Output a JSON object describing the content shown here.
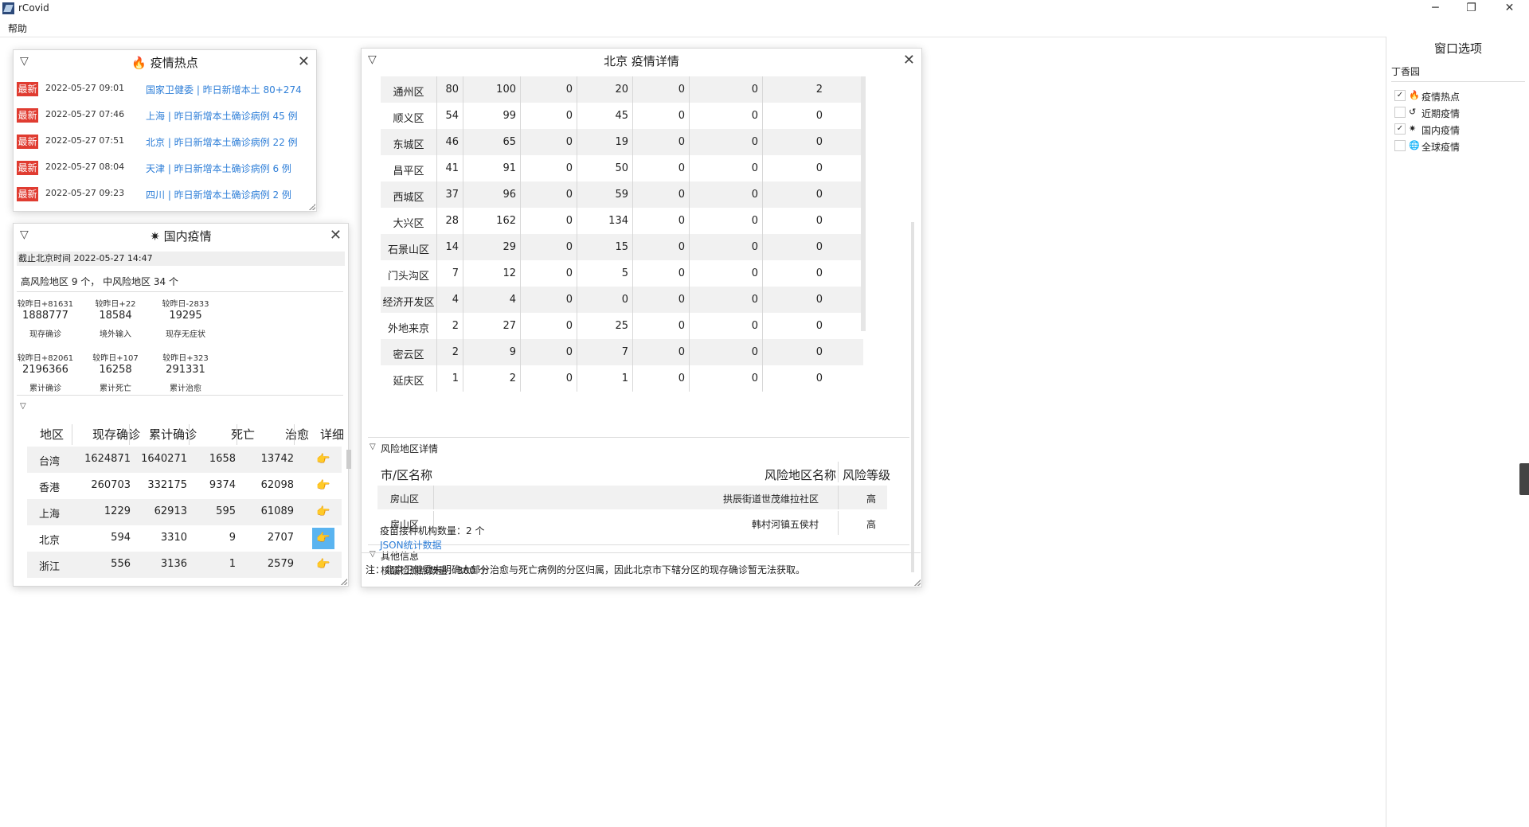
{
  "app": {
    "title": "rCovid"
  },
  "menu": {
    "help": "帮助"
  },
  "window_controls": {
    "minimize": "─",
    "restore": "❐",
    "close": "✕"
  },
  "hot": {
    "title": "疫情热点",
    "items": [
      {
        "badge": "最新",
        "time": "2022-05-27 09:01",
        "text": "国家卫健委 | 昨日新增本土 80+274"
      },
      {
        "badge": "最新",
        "time": "2022-05-27 07:46",
        "text": "上海 | 昨日新增本土确诊病例 45 例"
      },
      {
        "badge": "最新",
        "time": "2022-05-27 07:51",
        "text": "北京 | 昨日新增本土确诊病例 22 例"
      },
      {
        "badge": "最新",
        "time": "2022-05-27 08:04",
        "text": "天津 | 昨日新增本土确诊病例 6 例"
      },
      {
        "badge": "最新",
        "time": "2022-05-27 09:23",
        "text": "四川 | 昨日新增本土确诊病例 2 例"
      }
    ]
  },
  "domestic": {
    "title": "国内疫情",
    "deadline": "截止北京时间 2022-05-27 14:47",
    "risk": "高风险地区 9 个，  中风险地区 34 个",
    "stats_row1": [
      {
        "delta": "较昨日+81631",
        "value": "1888777",
        "label": "现存确诊"
      },
      {
        "delta": "较昨日+22",
        "value": "18584",
        "label": "境外输入"
      },
      {
        "delta": "较昨日-2833",
        "value": "19295",
        "label": "现存无症状"
      }
    ],
    "stats_row2": [
      {
        "delta": "较昨日+82061",
        "value": "2196366",
        "label": "累计确诊"
      },
      {
        "delta": "较昨日+107",
        "value": "16258",
        "label": "累计死亡"
      },
      {
        "delta": "较昨日+323",
        "value": "291331",
        "label": "累计治愈"
      }
    ],
    "table_headers": [
      "地区",
      "现存确诊",
      "累计确诊",
      "死亡",
      "治愈",
      "详细"
    ],
    "rows": [
      [
        "台湾",
        "1624871",
        "1640271",
        "1658",
        "13742"
      ],
      [
        "香港",
        "260703",
        "332175",
        "9374",
        "62098"
      ],
      [
        "上海",
        "1229",
        "62913",
        "595",
        "61089"
      ],
      [
        "北京",
        "594",
        "3310",
        "9",
        "2707"
      ],
      [
        "浙江",
        "556",
        "3136",
        "1",
        "2579"
      ]
    ],
    "active_row_index": 3
  },
  "beijing": {
    "title": "北京 疫情详情",
    "rows": [
      [
        "通州区",
        "80",
        "100",
        "0",
        "20",
        "0",
        "0",
        "2"
      ],
      [
        "顺义区",
        "54",
        "99",
        "0",
        "45",
        "0",
        "0",
        "0"
      ],
      [
        "东城区",
        "46",
        "65",
        "0",
        "19",
        "0",
        "0",
        "0"
      ],
      [
        "昌平区",
        "41",
        "91",
        "0",
        "50",
        "0",
        "0",
        "0"
      ],
      [
        "西城区",
        "37",
        "96",
        "0",
        "59",
        "0",
        "0",
        "0"
      ],
      [
        "大兴区",
        "28",
        "162",
        "0",
        "134",
        "0",
        "0",
        "0"
      ],
      [
        "石景山区",
        "14",
        "29",
        "0",
        "15",
        "0",
        "0",
        "0"
      ],
      [
        "门头沟区",
        "7",
        "12",
        "0",
        "5",
        "0",
        "0",
        "0"
      ],
      [
        "经济开发区",
        "4",
        "4",
        "0",
        "0",
        "0",
        "0",
        "0"
      ],
      [
        "外地来京",
        "2",
        "27",
        "0",
        "25",
        "0",
        "0",
        "0"
      ],
      [
        "密云区",
        "2",
        "9",
        "0",
        "7",
        "0",
        "0",
        "0"
      ],
      [
        "延庆区",
        "1",
        "2",
        "0",
        "1",
        "0",
        "0",
        "0"
      ]
    ],
    "risk_section": {
      "title": "风险地区详情",
      "headers": [
        "市/区名称",
        "风险地区名称",
        "风险等级"
      ],
      "rows": [
        [
          "房山区",
          "拱辰街道世茂维拉社区",
          "高"
        ],
        [
          "房山区",
          "韩村河镇五侯村",
          "高"
        ]
      ]
    },
    "other_section": {
      "title": "其他信息",
      "test_sites": "核酸检测点数量：300 个",
      "vaccine_sites": "疫苗接种机构数量：2 个",
      "json_link": "JSON统计数据"
    },
    "note": "注：北京卫健委未明确大部分治愈与死亡病例的分区归属，因此北京市下辖分区的现存确诊暂无法获取。"
  },
  "options": {
    "title": "窗口选项",
    "theme": "丁香园",
    "items": [
      {
        "label": "疫情热点",
        "checked": true,
        "icon": "fire-icon"
      },
      {
        "label": "近期疫情",
        "checked": false,
        "icon": "chart-icon"
      },
      {
        "label": "国内疫情",
        "checked": true,
        "icon": "virus-icon"
      },
      {
        "label": "全球疫情",
        "checked": false,
        "icon": "globe-icon"
      }
    ]
  },
  "colors": {
    "badge": "#e03c31",
    "link": "#2f7fd8",
    "active": "#5ab4f0"
  }
}
